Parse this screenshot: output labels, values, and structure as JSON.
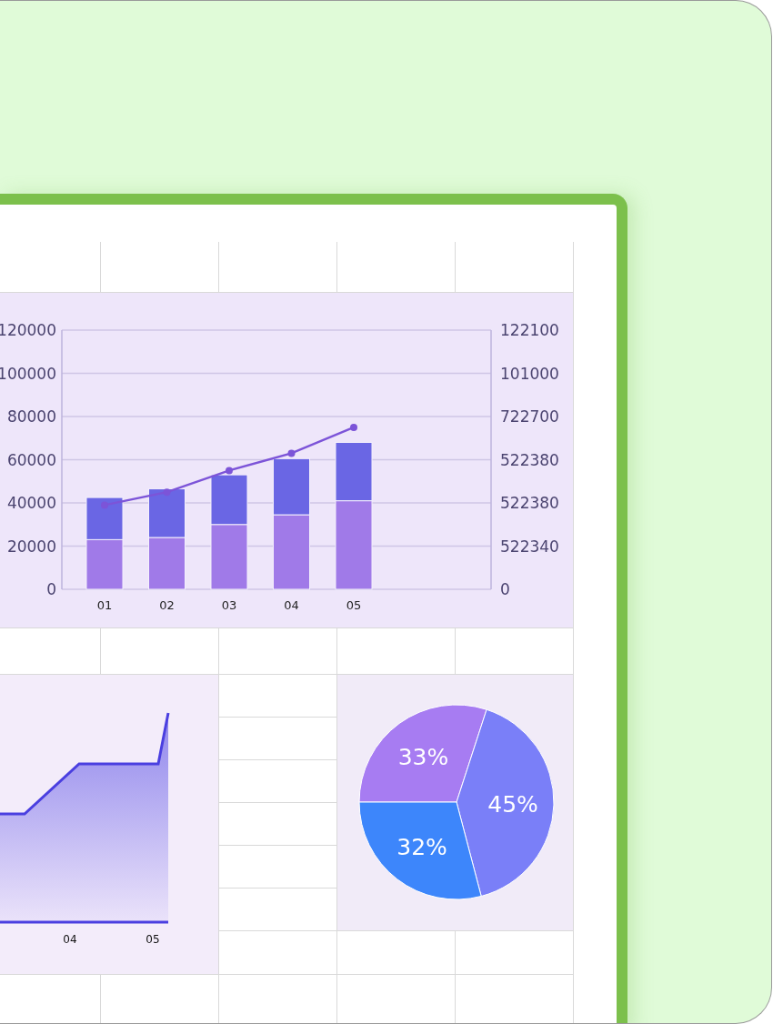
{
  "spreadsheet": {
    "bar_chart": {
      "chart_data": {
        "type": "bar",
        "categories": [
          "01",
          "02",
          "03",
          "04",
          "05"
        ],
        "stacked": true,
        "ylim": [
          0,
          120000
        ],
        "yticks": [
          {
            "value": 0,
            "label": "0"
          },
          {
            "value": 20000,
            "label": "20000"
          },
          {
            "value": 40000,
            "label": "40000"
          },
          {
            "value": 60000,
            "label": "60000"
          },
          {
            "value": 80000,
            "label": "80000"
          },
          {
            "value": 100000,
            "label": "100000"
          },
          {
            "value": 120000,
            "label": "120000"
          }
        ],
        "grid": true,
        "series": [
          {
            "type": "bar",
            "color": "#a07ae8",
            "values": [
              23000,
              24000,
              30000,
              34500,
              41000
            ]
          },
          {
            "type": "bar",
            "color": "#6a66e4",
            "values": [
              19500,
              22500,
              23000,
              26000,
              27000
            ]
          },
          {
            "type": "line",
            "marker": "o",
            "color": "#7c54d8",
            "values": [
              39000,
              45000,
              55000,
              63000,
              75000
            ]
          }
        ]
      },
      "right_axis_labels": [
        "122100",
        "101000",
        "722700",
        "522380",
        "522380",
        "522340",
        "0"
      ]
    },
    "area_chart": {
      "x_labels": [
        "04",
        "05"
      ]
    },
    "pie_chart": {
      "chart_data": {
        "type": "pie",
        "values": [
          33,
          45,
          32
        ],
        "value_labels": [
          "33%",
          "45%",
          "32%"
        ],
        "colors": [
          "#a77cf2",
          "#7a7ff8",
          "#3d86fb"
        ]
      }
    }
  }
}
